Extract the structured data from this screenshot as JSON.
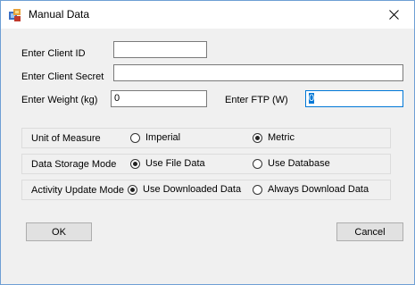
{
  "window": {
    "title": "Manual Data"
  },
  "fields": {
    "client_id_label": "Enter Client ID",
    "client_id_value": "",
    "client_secret_label": "Enter Client Secret",
    "client_secret_value": "",
    "weight_label": "Enter Weight (kg)",
    "weight_value": "0",
    "ftp_label": "Enter FTP (W)",
    "ftp_value": "0"
  },
  "options": {
    "unit": {
      "label": "Unit of Measure",
      "option1": "Imperial",
      "option2": "Metric",
      "selected": "Metric"
    },
    "storage": {
      "label": "Data Storage Mode",
      "option1": "Use File Data",
      "option2": "Use Database",
      "selected": "Use File Data"
    },
    "activity": {
      "label": "Activity Update Mode",
      "option1": "Use Downloaded Data",
      "option2": "Always Download Data",
      "selected": "Use Downloaded Data"
    }
  },
  "buttons": {
    "ok": "OK",
    "cancel": "Cancel"
  },
  "icons": {
    "app": "app-icon",
    "close": "close-icon"
  }
}
